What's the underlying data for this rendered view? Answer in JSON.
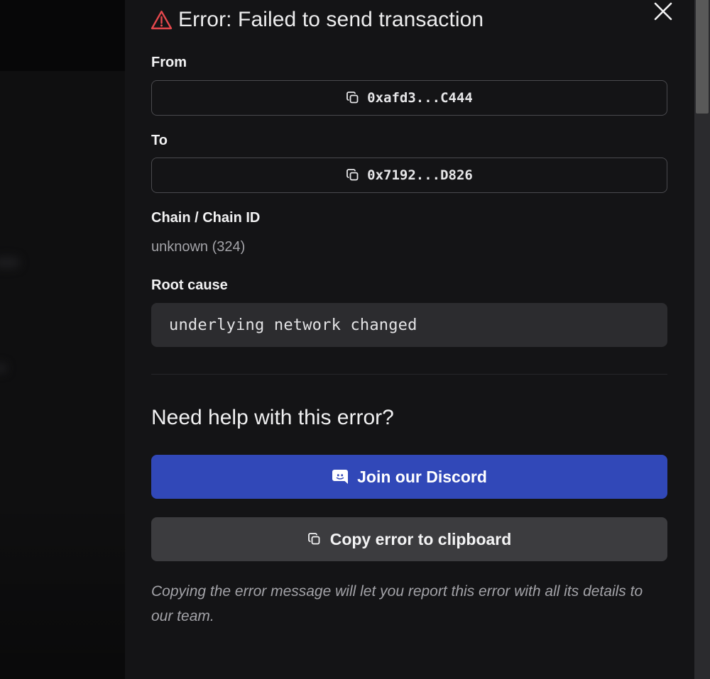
{
  "dialog": {
    "title": "Error: Failed to send transaction",
    "title_icon": "warning-triangle-icon",
    "close_icon": "close-icon",
    "error_color": "#e5484d"
  },
  "fields": {
    "from": {
      "label": "From",
      "value": "0xafd3...C444",
      "icon": "copy-icon"
    },
    "to": {
      "label": "To",
      "value": "0x7192...D826",
      "icon": "copy-icon"
    },
    "chain": {
      "label": "Chain / Chain ID",
      "value": "unknown (324)"
    },
    "root_cause": {
      "label": "Root cause",
      "value": "underlying network changed"
    }
  },
  "help": {
    "title": "Need help with this error?",
    "discord_button": {
      "label": "Join our Discord",
      "icon": "discord-icon",
      "color": "#3148b8"
    },
    "copy_button": {
      "label": "Copy error to clipboard",
      "icon": "copy-icon"
    },
    "note": "Copying the error message will let you report this error with all its details to our team."
  }
}
